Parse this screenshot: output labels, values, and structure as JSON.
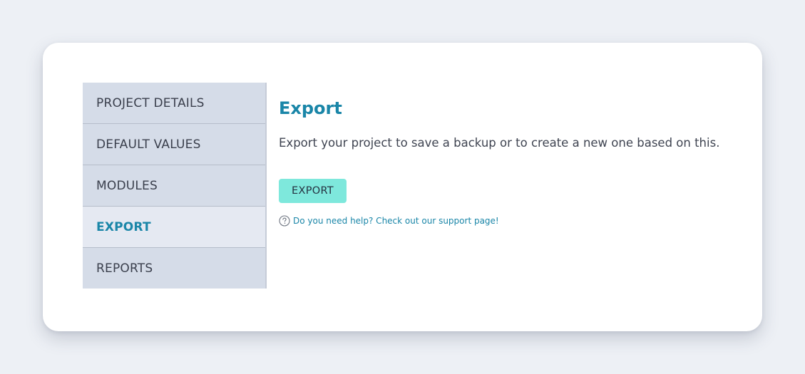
{
  "sidebar": {
    "items": [
      {
        "label": "PROJECT DETAILS"
      },
      {
        "label": "DEFAULT VALUES"
      },
      {
        "label": "MODULES"
      },
      {
        "label": "EXPORT",
        "active": true
      },
      {
        "label": "REPORTS"
      }
    ]
  },
  "main": {
    "title": "Export",
    "description": "Export your project to save a backup or to create a new one based on this.",
    "export_button_label": "EXPORT",
    "help_text": "Do you need help? Check out our support page!",
    "help_icon": "question-circle-icon"
  },
  "colors": {
    "page_background": "#edf0f5",
    "card_background": "#ffffff",
    "sidebar_background": "#d5dce8",
    "sidebar_active_background": "#e5e9f2",
    "accent": "#1a86a8",
    "button_background": "#7ee8dc"
  }
}
